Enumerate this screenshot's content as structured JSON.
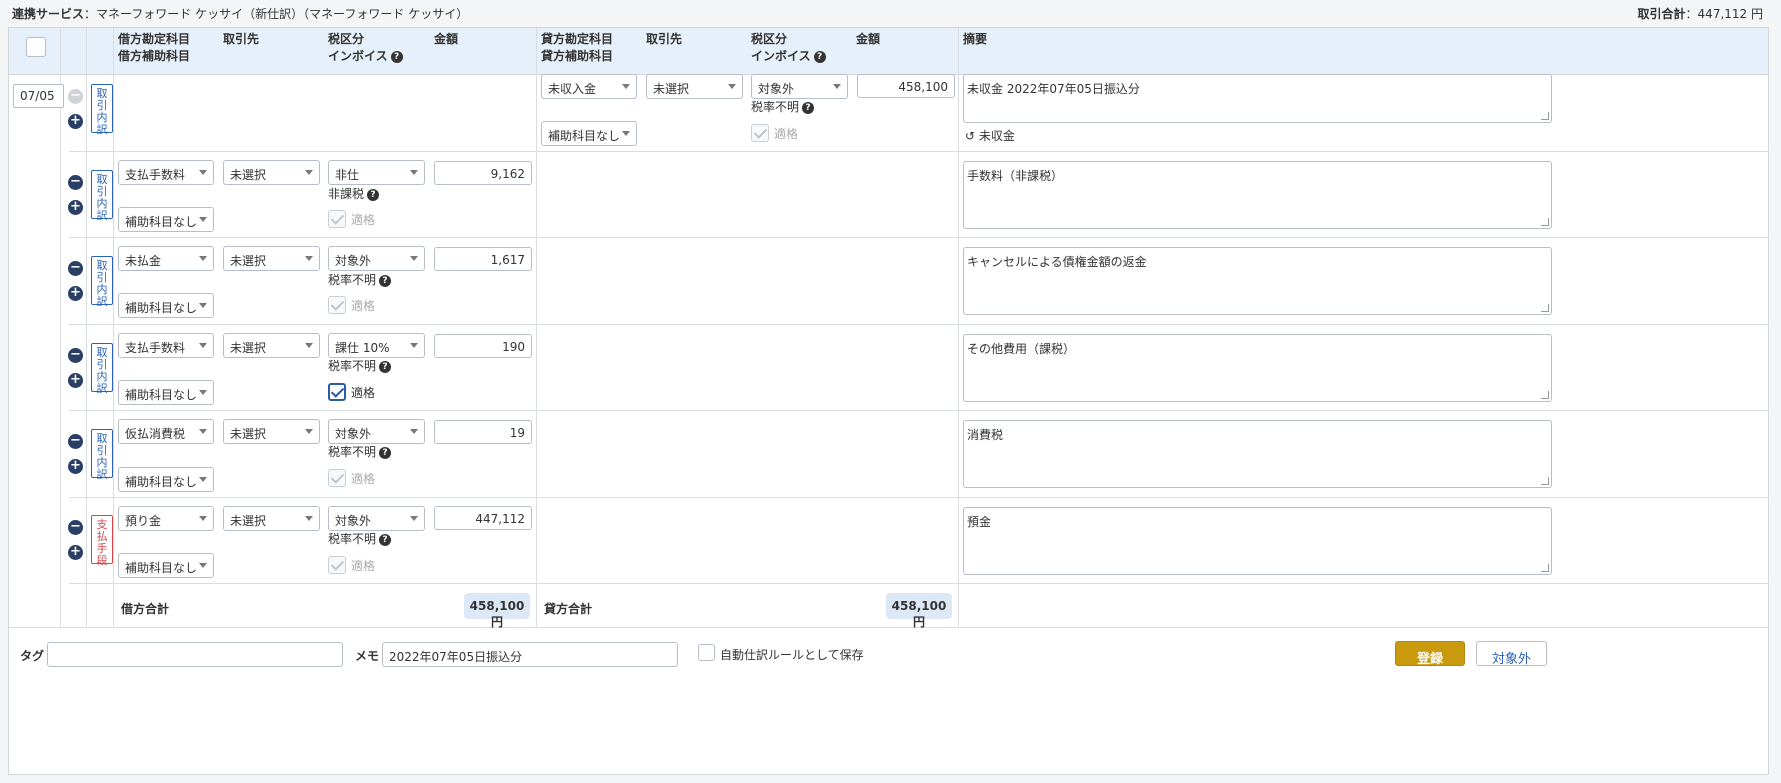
{
  "topbar": {
    "service_label": "連携サービス",
    "service_value": "：マネーフォワード ケッサイ（新仕訳）（マネーフォワード ケッサイ）",
    "total_label": "取引合計",
    "total_value": "：447,112 円"
  },
  "header": {
    "debit_account": "借方勘定科目",
    "debit_sub_account": "借方補助科目",
    "debit_partner": "取引先",
    "debit_tax": "税区分",
    "debit_invoice": "インボイス",
    "debit_amount": "金額",
    "credit_account": "貸方勘定科目",
    "credit_sub_account": "貸方補助科目",
    "credit_partner": "取引先",
    "credit_tax": "税区分",
    "credit_invoice": "インボイス",
    "credit_amount": "金額",
    "memo": "摘要"
  },
  "date": "07/05",
  "rows": [
    {
      "tag": "取引内訳",
      "credit_account": "未収入金",
      "credit_partner": "未選択",
      "credit_tax": "対象外",
      "credit_amount": "458,100",
      "credit_sub": "補助科目なし",
      "tax_note": "税率不明",
      "fit_label": "適格",
      "memo": "未収金 2022年07年05日振込分",
      "undo_label": "未収金"
    },
    {
      "tag": "取引内訳",
      "account": "支払手数料",
      "partner": "未選択",
      "tax": "非仕",
      "amount": "9,162",
      "sub": "補助科目なし",
      "tax_note": "非課税",
      "fit_label": "適格",
      "memo": "手数料（非課税）"
    },
    {
      "tag": "取引内訳",
      "account": "未払金",
      "partner": "未選択",
      "tax": "対象外",
      "amount": "1,617",
      "sub": "補助科目なし",
      "tax_note": "税率不明",
      "fit_label": "適格",
      "memo": "キャンセルによる債権金額の返金"
    },
    {
      "tag": "取引内訳",
      "account": "支払手数料",
      "partner": "未選択",
      "tax": "課仕 10%",
      "amount": "190",
      "sub": "補助科目なし",
      "tax_note": "税率不明",
      "fit_label": "適格",
      "memo": "その他費用（課税）"
    },
    {
      "tag": "取引内訳",
      "account": "仮払消費税",
      "partner": "未選択",
      "tax": "対象外",
      "amount": "19",
      "sub": "補助科目なし",
      "tax_note": "税率不明",
      "fit_label": "適格",
      "memo": "消費税"
    },
    {
      "tag": "支払手段",
      "account": "預り金",
      "partner": "未選択",
      "tax": "対象外",
      "amount": "447,112",
      "sub": "補助科目なし",
      "tax_note": "税率不明",
      "fit_label": "適格",
      "memo": "預金"
    }
  ],
  "totals": {
    "debit_label": "借方合計",
    "debit_value": "458,100円",
    "credit_label": "貸方合計",
    "credit_value": "458,100円"
  },
  "footer": {
    "tag_label": "タグ",
    "tag_value": "",
    "memo_label": "メモ",
    "memo_value": "2022年07年05日振込分",
    "auto_rule_label": "自動仕訳ルールとして保存",
    "register_button": "登録",
    "exclude_button": "対象外"
  },
  "colors": {
    "header_bg": "#e6f0fa",
    "primary_button": "#c99a0e",
    "link_blue": "#2a63b6",
    "tag_red": "#d54545"
  }
}
